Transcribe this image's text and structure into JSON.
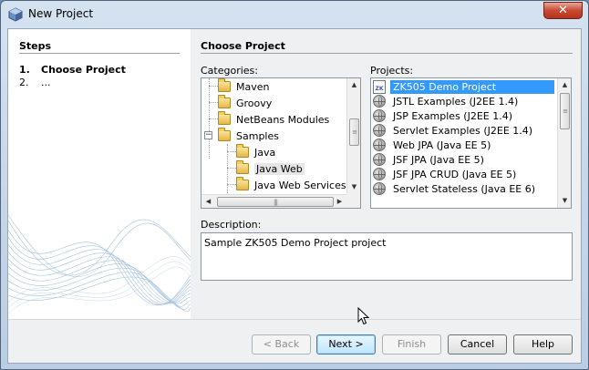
{
  "window": {
    "title": "New Project",
    "close_label": "✕"
  },
  "steps": {
    "heading": "Steps",
    "items": [
      {
        "num": "1.",
        "label": "Choose Project"
      },
      {
        "num": "2.",
        "label": "..."
      }
    ]
  },
  "main": {
    "title": "Choose Project",
    "categories_label": "Categories:",
    "projects_label": "Projects:",
    "description_label": "Description:",
    "description_text": "Sample ZK505 Demo Project project"
  },
  "categories": [
    {
      "label": "Maven",
      "level": 1,
      "expander": ""
    },
    {
      "label": "Groovy",
      "level": 1,
      "expander": ""
    },
    {
      "label": "NetBeans Modules",
      "level": 1,
      "expander": ""
    },
    {
      "label": "Samples",
      "level": 1,
      "expander": "−"
    },
    {
      "label": "Java",
      "level": 2,
      "expander": ""
    },
    {
      "label": "Java Web",
      "level": 2,
      "expander": ""
    },
    {
      "label": "Java Web Services",
      "level": 2,
      "expander": ""
    }
  ],
  "projects": [
    {
      "label": "ZK505 Demo Project",
      "icon": "zk-project-icon",
      "selected": true
    },
    {
      "label": "JSTL Examples (J2EE 1.4)",
      "icon": "globe-icon"
    },
    {
      "label": "JSP Examples (J2EE 1.4)",
      "icon": "globe-icon"
    },
    {
      "label": "Servlet Examples (J2EE 1.4)",
      "icon": "globe-icon"
    },
    {
      "label": "Web JPA (Java EE 5)",
      "icon": "globe-icon"
    },
    {
      "label": "JSF JPA (Java EE 5)",
      "icon": "globe-icon"
    },
    {
      "label": "JSF JPA CRUD (Java EE 5)",
      "icon": "globe-icon"
    },
    {
      "label": "Servlet Stateless (Java EE 6)",
      "icon": "globe-icon"
    }
  ],
  "buttons": {
    "back": "< Back",
    "next": "Next >",
    "finish": "Finish",
    "cancel": "Cancel",
    "help": "Help"
  },
  "colors": {
    "selection": "#3399ff",
    "default_button_border": "#3c7fb1"
  }
}
